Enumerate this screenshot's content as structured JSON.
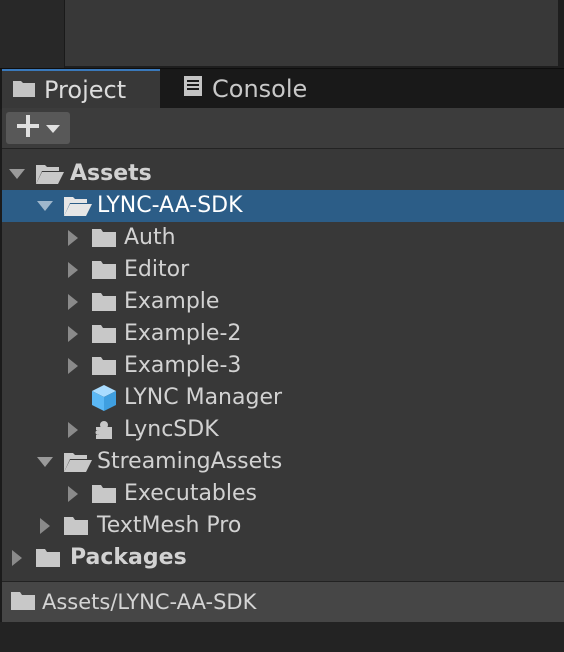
{
  "tabs": [
    {
      "label": "Project",
      "icon": "folder-icon",
      "active": true
    },
    {
      "label": "Console",
      "icon": "console-icon",
      "active": false
    }
  ],
  "toolbar": {
    "create_icon": "plus-icon",
    "dropdown_icon": "triangle-down-icon"
  },
  "tree": {
    "rows": [
      {
        "label": "Assets",
        "depth": 0,
        "expanded": true,
        "icon": "folder-open-icon",
        "bold": true
      },
      {
        "label": "LYNC-AA-SDK",
        "depth": 1,
        "expanded": true,
        "icon": "folder-open-icon",
        "selected": true
      },
      {
        "label": "Auth",
        "depth": 2,
        "expanded": false,
        "icon": "folder-icon"
      },
      {
        "label": "Editor",
        "depth": 2,
        "expanded": false,
        "icon": "folder-icon"
      },
      {
        "label": "Example",
        "depth": 2,
        "expanded": false,
        "icon": "folder-icon"
      },
      {
        "label": "Example-2",
        "depth": 2,
        "expanded": false,
        "icon": "folder-icon"
      },
      {
        "label": "Example-3",
        "depth": 2,
        "expanded": false,
        "icon": "folder-icon"
      },
      {
        "label": "LYNC Manager",
        "depth": 2,
        "icon": "prefab-cube-icon"
      },
      {
        "label": "LyncSDK",
        "depth": 2,
        "expanded": false,
        "icon": "assembly-puzzle-icon"
      },
      {
        "label": "StreamingAssets",
        "depth": 1,
        "expanded": true,
        "icon": "folder-open-icon"
      },
      {
        "label": "Executables",
        "depth": 2,
        "expanded": false,
        "icon": "folder-icon"
      },
      {
        "label": "TextMesh Pro",
        "depth": 1,
        "expanded": false,
        "icon": "folder-icon"
      },
      {
        "label": "Packages",
        "depth": 0,
        "expanded": false,
        "icon": "folder-icon",
        "bold": true
      }
    ]
  },
  "footer": {
    "path": "Assets/LYNC-AA-SDK",
    "icon": "folder-icon"
  },
  "colors": {
    "selection": "#2c5d87",
    "tab_accent": "#3a79bb",
    "prefab": "#5bb8f5"
  }
}
